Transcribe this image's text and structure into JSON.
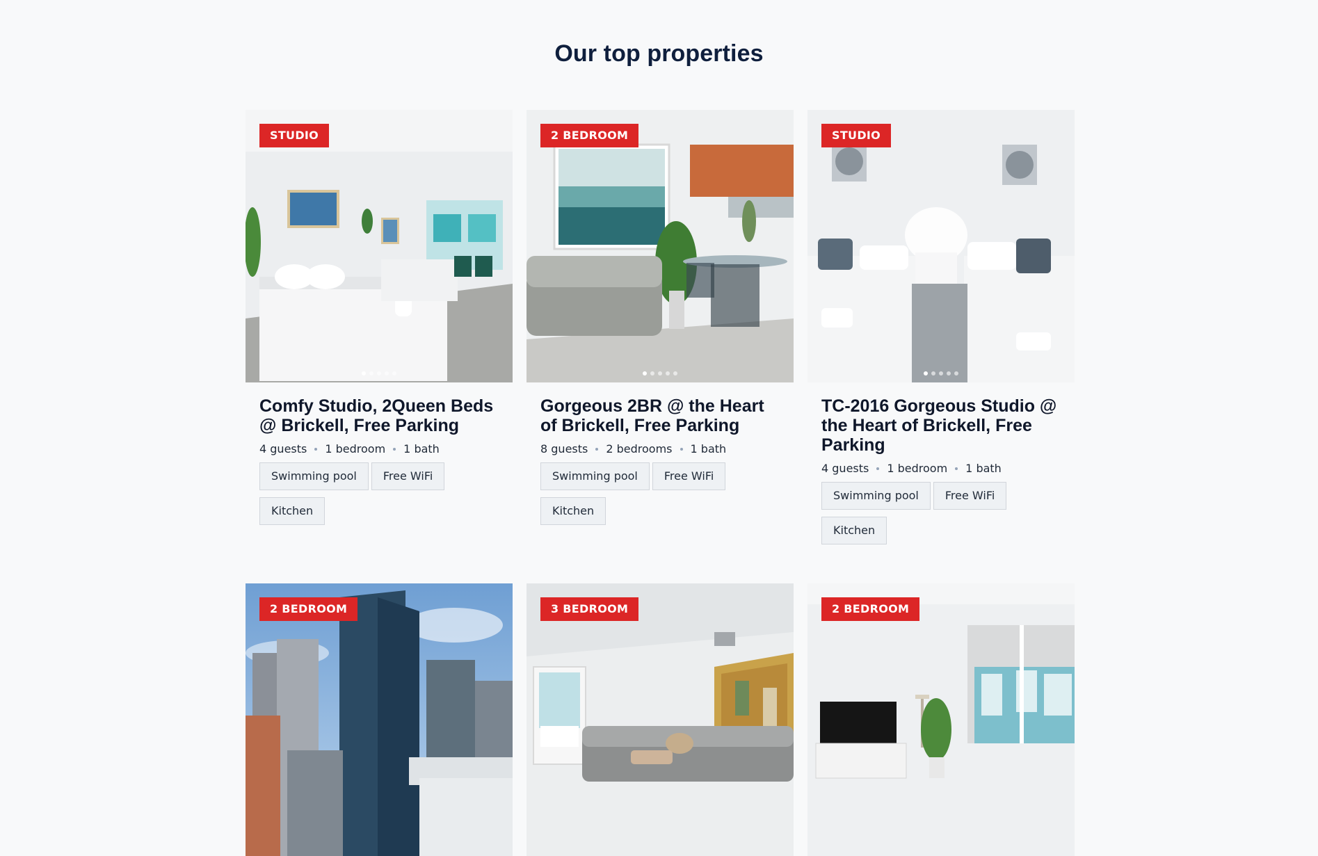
{
  "header": {
    "title": "Our top properties"
  },
  "properties": [
    {
      "badge": "STUDIO",
      "title": "Comfy Studio, 2Queen Beds @ Brickell, Free Parking",
      "guests": "4 guests",
      "bedrooms": "1 bedroom",
      "baths": "1 bath",
      "amenities": [
        "Swimming pool",
        "Free WiFi",
        "Kitchen"
      ]
    },
    {
      "badge": "2 BEDROOM",
      "title": "Gorgeous 2BR @ the Heart of Brickell, Free Parking",
      "guests": "8 guests",
      "bedrooms": "2 bedrooms",
      "baths": "1 bath",
      "amenities": [
        "Swimming pool",
        "Free WiFi",
        "Kitchen"
      ]
    },
    {
      "badge": "STUDIO",
      "title": "TC-2016 Gorgeous Studio @ the Heart of Brickell, Free Parking",
      "guests": "4 guests",
      "bedrooms": "1 bedroom",
      "baths": "1 bath",
      "amenities": [
        "Swimming pool",
        "Free WiFi",
        "Kitchen"
      ]
    },
    {
      "badge": "2 BEDROOM"
    },
    {
      "badge": "3 BEDROOM"
    },
    {
      "badge": "2 BEDROOM"
    }
  ],
  "colors": {
    "badge": "#dc2626",
    "title": "#0f1f3d",
    "background": "#f8f9fa"
  }
}
